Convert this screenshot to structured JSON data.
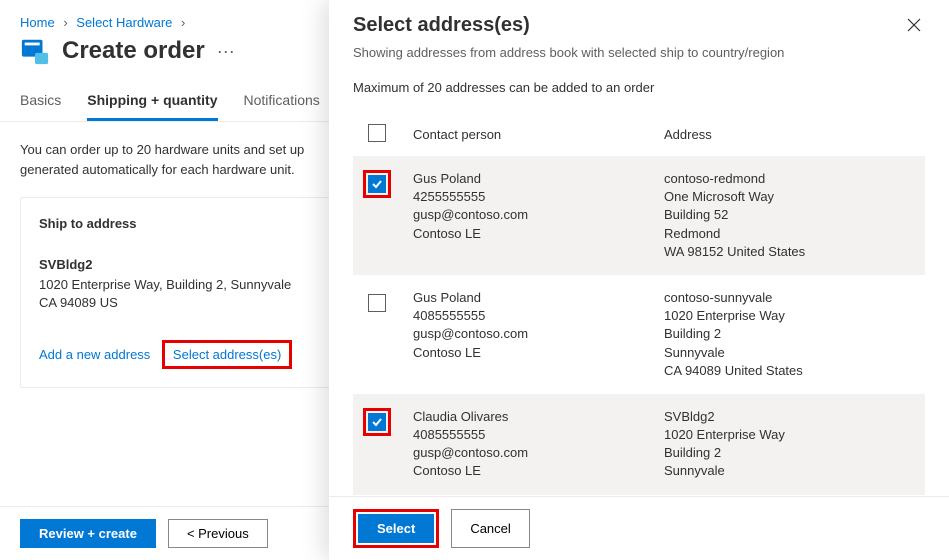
{
  "breadcrumb": {
    "home": "Home",
    "select_hw": "Select Hardware"
  },
  "header": {
    "title": "Create order"
  },
  "tabs": {
    "basics": "Basics",
    "shipping": "Shipping + quantity",
    "notifications": "Notifications"
  },
  "body": {
    "intro_line1": "You can order up to 20 hardware units and set up",
    "intro_line2": "generated automatically for each hardware unit."
  },
  "card": {
    "title": "Ship to address",
    "addr_name": "SVBldg2",
    "addr_line1": "1020 Enterprise Way, Building 2, Sunnyvale",
    "addr_line2": "CA 94089 US",
    "add_link": "Add a new address",
    "select_link": "Select address(es)"
  },
  "footer": {
    "review": "Review + create",
    "prev": "< Previous"
  },
  "panel": {
    "title": "Select address(es)",
    "subtitle": "Showing addresses from address book with selected ship to country/region",
    "maxnote": "Maximum of 20 addresses can be added to an order",
    "col_contact": "Contact person",
    "col_address": "Address",
    "select_btn": "Select",
    "cancel_btn": "Cancel",
    "rows": [
      {
        "checked": true,
        "contact": {
          "name": "Gus Poland",
          "phone": "4255555555",
          "email": "gusp@contoso.com",
          "company": "Contoso LE"
        },
        "address": {
          "l1": "contoso-redmond",
          "l2": "One Microsoft Way",
          "l3": "Building 52",
          "l4": "Redmond",
          "l5": "WA 98152 United States"
        }
      },
      {
        "checked": false,
        "contact": {
          "name": "Gus Poland",
          "phone": "4085555555",
          "email": "gusp@contoso.com",
          "company": "Contoso LE"
        },
        "address": {
          "l1": "contoso-sunnyvale",
          "l2": "1020 Enterprise Way",
          "l3": "Building 2",
          "l4": "Sunnyvale",
          "l5": "CA 94089 United States"
        }
      },
      {
        "checked": true,
        "contact": {
          "name": "Claudia Olivares",
          "phone": "4085555555",
          "email": "gusp@contoso.com",
          "company": "Contoso LE"
        },
        "address": {
          "l1": "SVBldg2",
          "l2": "1020 Enterprise Way",
          "l3": "Building 2",
          "l4": "Sunnyvale",
          "l5": ""
        }
      }
    ]
  }
}
